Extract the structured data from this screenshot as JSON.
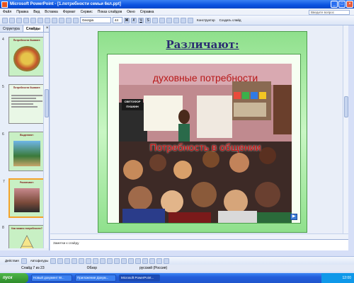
{
  "window": {
    "title": "Microsoft PowerPoint - [1.потребности семьи 6кл.ppt]",
    "minimize": "_",
    "maximize": "□",
    "close": "×"
  },
  "menu": {
    "items": [
      "Файл",
      "Правка",
      "Вид",
      "Вставка",
      "Формат",
      "Сервис",
      "Показ слайдов",
      "Окно",
      "Справка"
    ],
    "help_placeholder": "Введите вопрос"
  },
  "toolbar": {
    "font": "Georgia",
    "size": "44",
    "bold": "Ж",
    "italic": "К",
    "underline": "Ч",
    "shadow": "S",
    "designer_label": "Конструктор",
    "new_slide_label": "Создать слайд"
  },
  "panel": {
    "tabs": [
      "Структура",
      "Слайды"
    ],
    "active_tab": "Слайды",
    "close": "×",
    "thumbs": [
      {
        "num": "4",
        "title": "Потребности бывают:"
      },
      {
        "num": "5",
        "title": "Потребности бывают:"
      },
      {
        "num": "6",
        "title": "Выделяют:"
      },
      {
        "num": "7",
        "title": "Различают:"
      },
      {
        "num": "8",
        "title": "Как можно потребности?"
      }
    ]
  },
  "slide": {
    "title": "Различают:",
    "caption_top": "духовные потребности",
    "caption_mid": "Потребность в общении",
    "board_sign": "СВЕТОФОР ПУШКИН",
    "nav_symbol": "▶"
  },
  "notes": {
    "placeholder": "Заметки к слайду"
  },
  "drawbar": {
    "actions_label": "Действия",
    "autoshapes_label": "Автофигуры"
  },
  "status": {
    "slide_info": "Слайд 7 из 23",
    "design": "Обзор",
    "language": "русский (Россия)"
  },
  "taskbar": {
    "start_label": "пуск",
    "tasks": [
      "Новый документ W...",
      "Приложение Докум...",
      "Microsoft PowerPoint..."
    ],
    "clock": "12:00"
  },
  "colors": {
    "slide_bg": "#a8eca4",
    "title_color": "#2a2a72",
    "caption_color": "#d20b0b",
    "xp_blue": "#245edb"
  }
}
